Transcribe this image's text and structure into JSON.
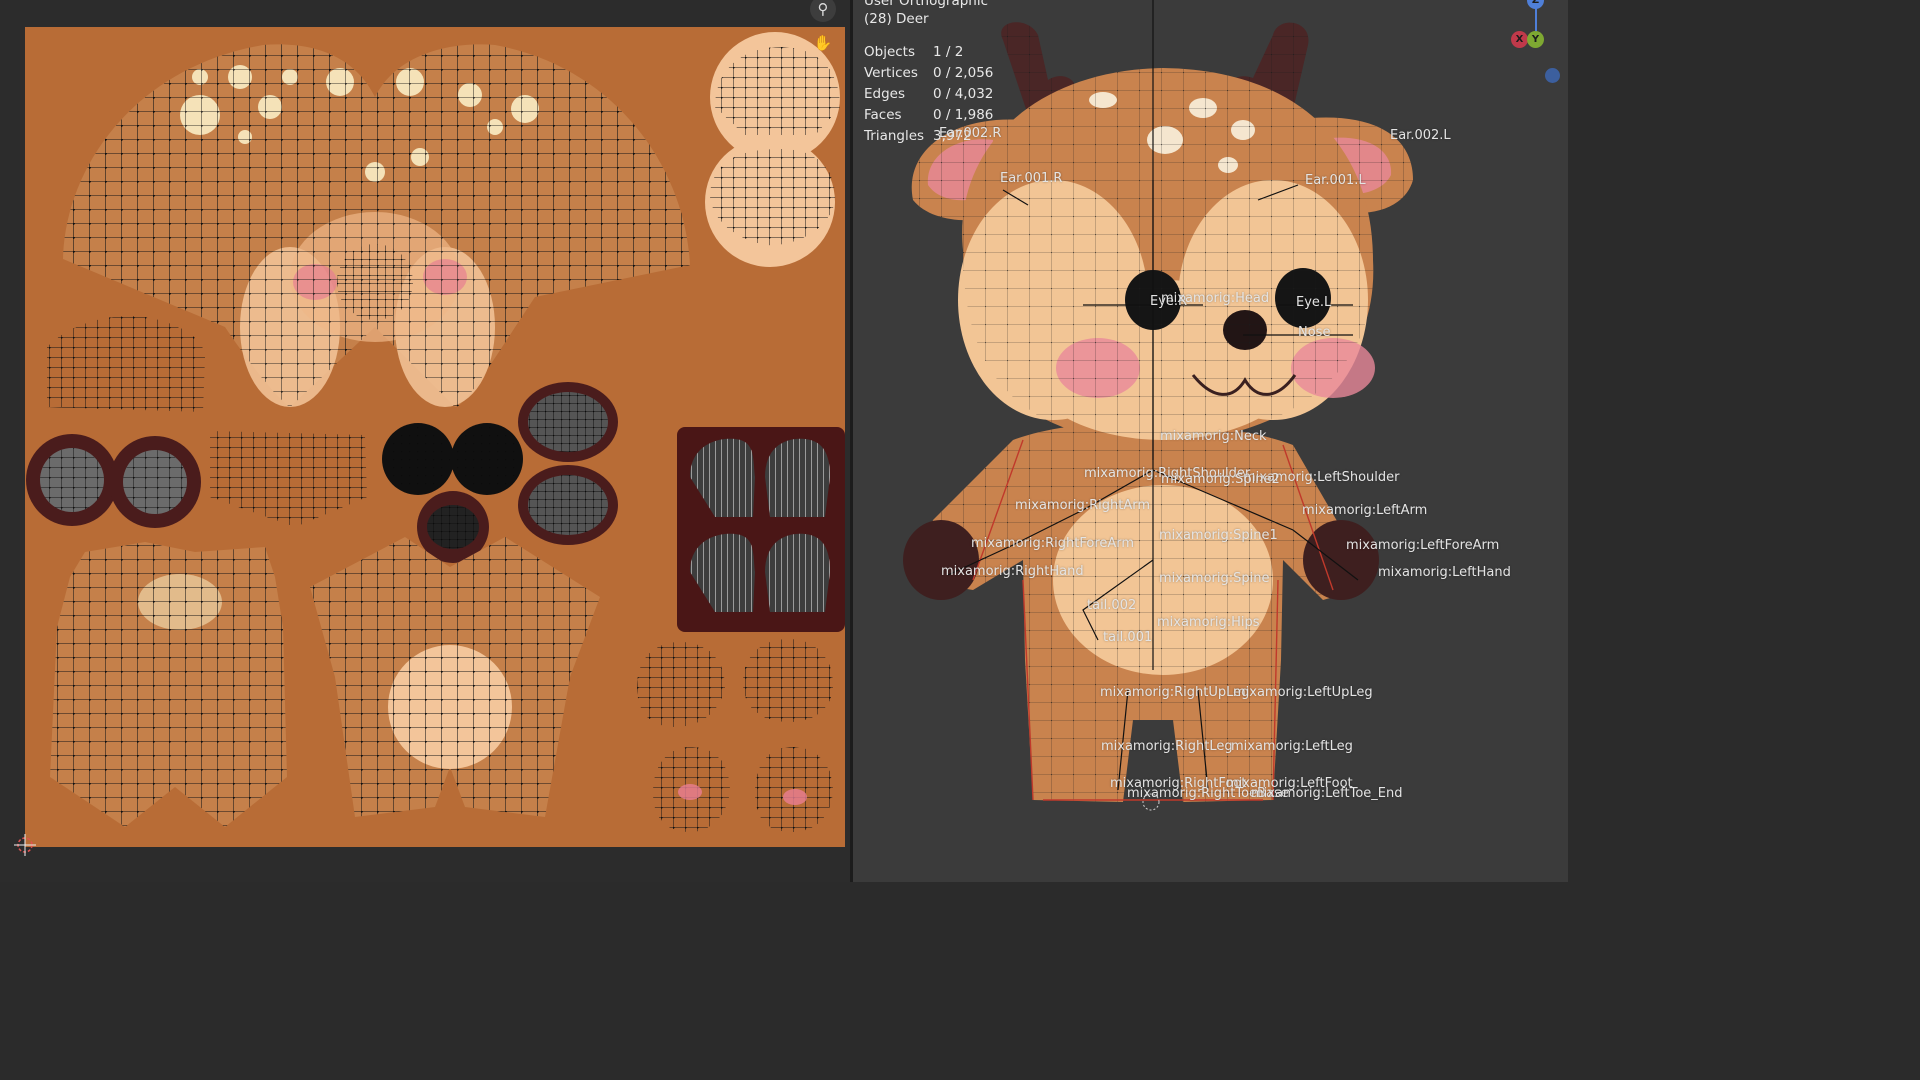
{
  "viewport": {
    "view_name": "User Orthographic",
    "object_name": "(28) Deer",
    "stats": [
      {
        "label": "Objects",
        "value": "1 / 2"
      },
      {
        "label": "Vertices",
        "value": "0 / 2,056"
      },
      {
        "label": "Edges",
        "value": "0 / 4,032"
      },
      {
        "label": "Faces",
        "value": "0 / 1,986"
      },
      {
        "label": "Triangles",
        "value": "3,972"
      }
    ],
    "bones": {
      "ear002r": "Ear.002.R",
      "ear002l": "Ear.002.L",
      "ear001r": "Ear.001.R",
      "ear001l": "Ear.001.L",
      "eyer": "Eye.R",
      "head": "mixamorig:Head",
      "eyel": "Eye.L",
      "nose": "Nose",
      "neck": "mixamorig:Neck",
      "rshoulder": "mixamorig:RightShoulder",
      "lshoulder": "mixamorig:LeftShoulder",
      "spine2": "mixamorig:Spine2",
      "rarm": "mixamorig:RightArm",
      "larm": "mixamorig:LeftArm",
      "spine1": "mixamorig:Spine1",
      "rforearm": "mixamorig:RightForeArm",
      "lforearm": "mixamorig:LeftForeArm",
      "rhand": "mixamorig:RightHand",
      "spine": "mixamorig:Spine",
      "lhand": "mixamorig:LeftHand",
      "tail002": "tail.002",
      "hips": "mixamorig:Hips",
      "tail001": "tail.001",
      "rupleg": "mixamorig:RightUpLeg",
      "lupleg": "mixamorig:LeftUpLeg",
      "rleg": "mixamorig:RightLeg",
      "lleg": "mixamorig:LeftLeg",
      "rfoot": "mixamorig:RightFoot",
      "lfoot": "mixamorig:LeftFoot",
      "rtoebase": "mixamorig:RightToeBase",
      "ltoeend": "mixamorig:LeftToe_End"
    },
    "gizmo": {
      "x": "X",
      "y": "Y",
      "z": "Z"
    }
  },
  "uv_editor": {
    "icons": {
      "zoom": "zoom-icon",
      "pan": "hand-icon"
    }
  },
  "colors": {
    "texture_bg": "#b86c36",
    "deer_body": "#c9834e",
    "deer_light": "#f2c595",
    "blush": "#e8889a",
    "dark_brown": "#4a2121",
    "mesh_line": "#141414",
    "viewport_bg": "#3b3b3b"
  }
}
